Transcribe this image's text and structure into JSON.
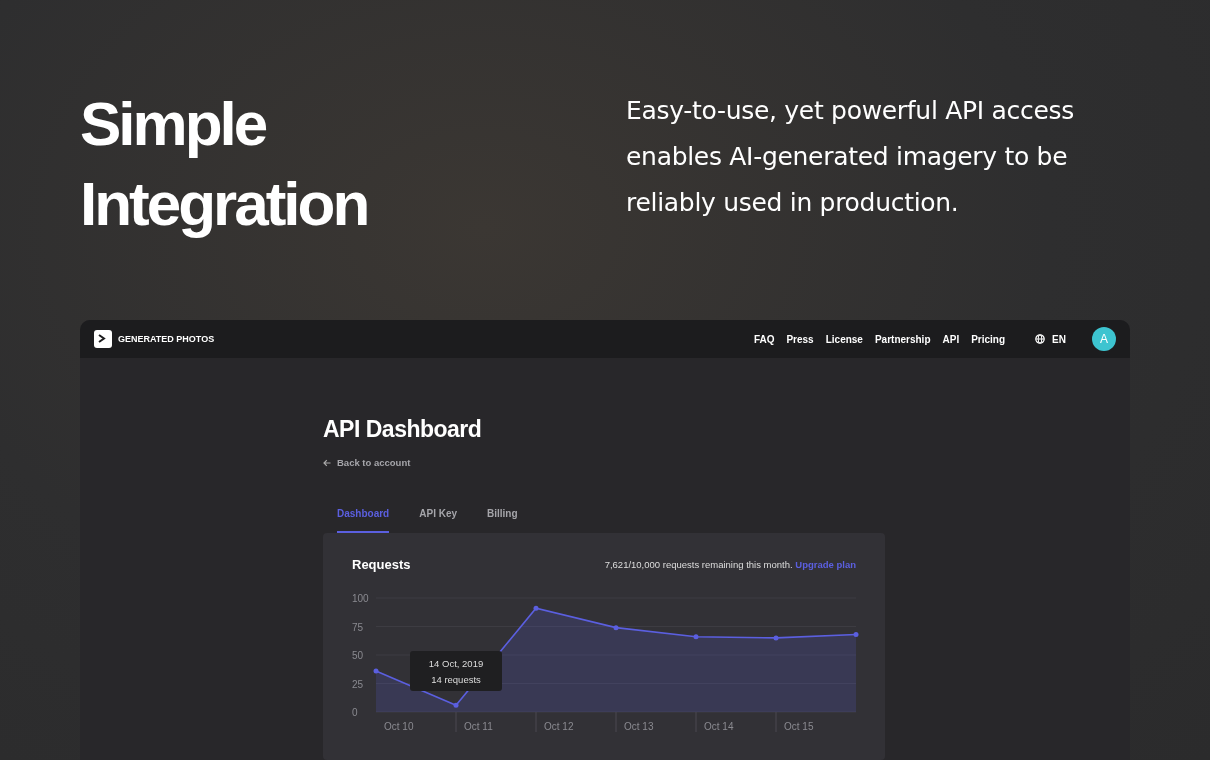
{
  "hero": {
    "title": "Simple Integration",
    "description": "Easy-to-use, yet powerful API access enables AI-generated imagery to be reliably used in production."
  },
  "app": {
    "logo_text": "GENERATED PHOTOS",
    "nav": [
      "FAQ",
      "Press",
      "License",
      "Partnership",
      "API",
      "Pricing"
    ],
    "language": "EN",
    "avatar": "A",
    "page_title": "API Dashboard",
    "back_link": "Back to account",
    "tabs": [
      {
        "label": "Dashboard",
        "selected": true
      },
      {
        "label": "API Key",
        "selected": false
      },
      {
        "label": "Billing",
        "selected": false
      }
    ],
    "card": {
      "title": "Requests",
      "quota": "7,621/10,000 requests remaining this month.",
      "upgrade_link": "Upgrade plan",
      "tooltip": {
        "date": "14 Oct, 2019",
        "count": "14 requests"
      },
      "chart_data": {
        "type": "area",
        "categories": [
          "Oct 10",
          "Oct 11",
          "Oct 12",
          "Oct 13",
          "Oct 14",
          "Oct 15",
          null
        ],
        "series": [
          {
            "color": "#5b5fe0",
            "values": [
              36,
              6,
              91,
              74,
              66,
              65,
              68
            ]
          }
        ],
        "ylim": [
          0,
          100
        ],
        "yticks": [
          0,
          25,
          50,
          75,
          100
        ],
        "grid": true
      }
    }
  }
}
